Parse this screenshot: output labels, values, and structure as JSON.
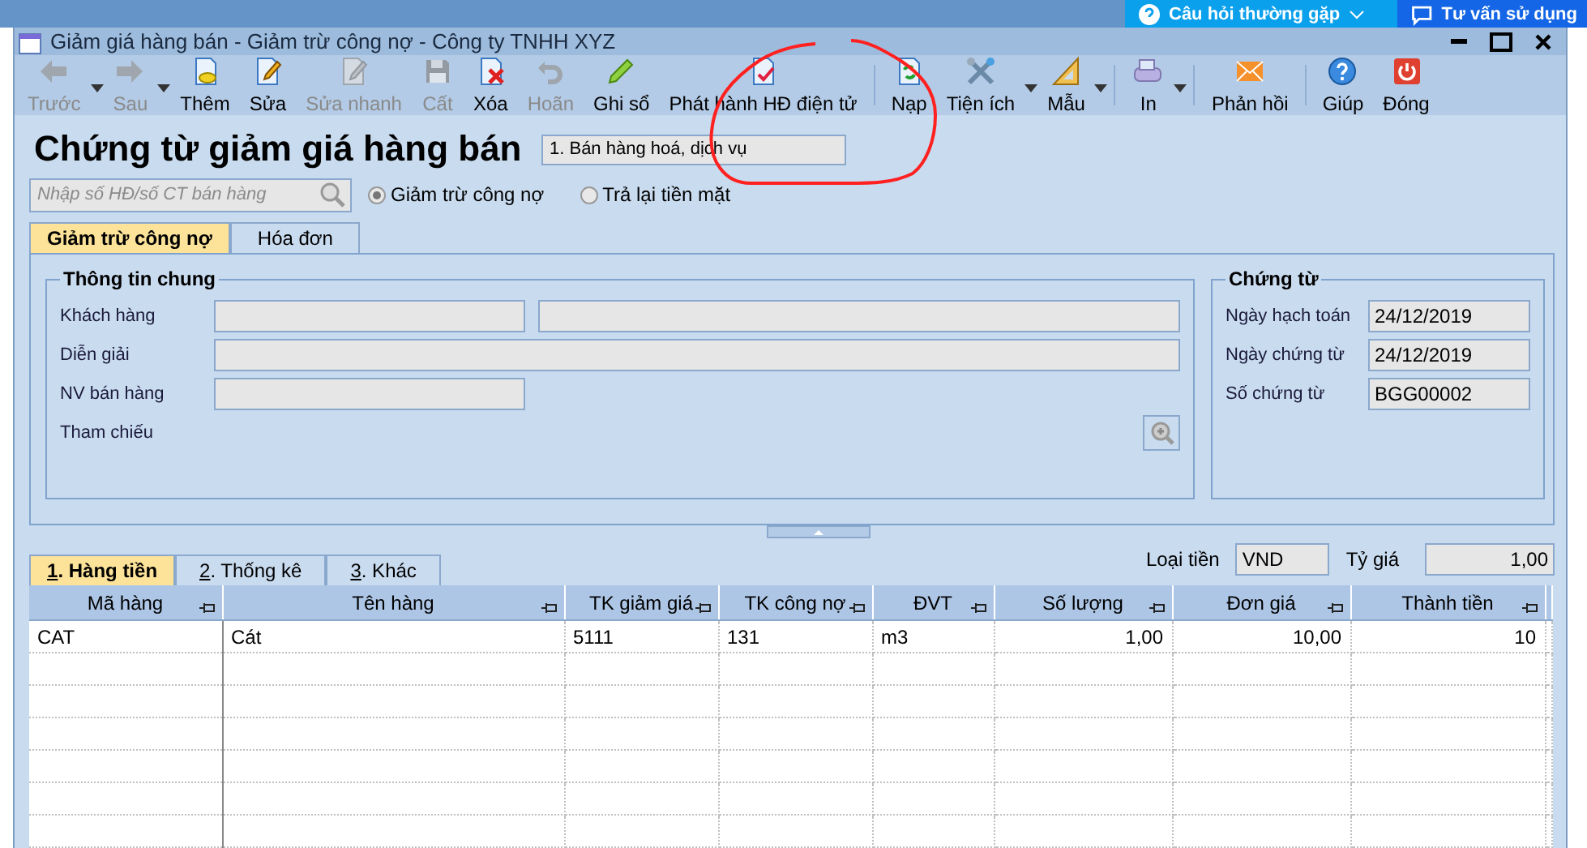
{
  "top_bar": {
    "buttons": [
      {
        "label": "Câu hỏi thường gặp",
        "kind": "faq",
        "dropdown": true
      },
      {
        "label": "Tư vấn sử dụng",
        "kind": "support",
        "dropdown": false
      }
    ]
  },
  "window": {
    "title": "Giảm giá hàng bán - Giảm trừ công nợ - Công ty TNHH XYZ"
  },
  "toolbar": [
    {
      "kind": "prev",
      "label": "Trước",
      "disabled": true,
      "dropdown": true
    },
    {
      "kind": "next",
      "label": "Sau",
      "disabled": true,
      "dropdown": true
    },
    {
      "kind": "add",
      "label": "Thêm",
      "disabled": false,
      "dropdown": false
    },
    {
      "kind": "edit",
      "label": "Sửa",
      "disabled": false,
      "dropdown": false
    },
    {
      "kind": "quick-edit",
      "label": "Sửa nhanh",
      "disabled": true,
      "dropdown": false
    },
    {
      "kind": "save",
      "label": "Cất",
      "disabled": true,
      "dropdown": false
    },
    {
      "kind": "delete",
      "label": "Xóa",
      "disabled": false,
      "dropdown": false
    },
    {
      "kind": "undo",
      "label": "Hoãn",
      "disabled": true,
      "dropdown": false
    },
    {
      "kind": "post",
      "label": "Ghi sổ",
      "disabled": false,
      "dropdown": false
    },
    {
      "kind": "einvoice",
      "label": "Phát hành HĐ điện tử",
      "disabled": false,
      "dropdown": false
    },
    {
      "kind": "separator"
    },
    {
      "kind": "reload",
      "label": "Nạp",
      "disabled": false,
      "dropdown": false
    },
    {
      "kind": "tools",
      "label": "Tiện ích",
      "disabled": false,
      "dropdown": true
    },
    {
      "kind": "template",
      "label": "Mẫu",
      "disabled": false,
      "dropdown": true
    },
    {
      "kind": "separator"
    },
    {
      "kind": "print",
      "label": "In",
      "disabled": false,
      "dropdown": true
    },
    {
      "kind": "separator"
    },
    {
      "kind": "feedback",
      "label": "Phản hồi",
      "disabled": false,
      "dropdown": false
    },
    {
      "kind": "separator"
    },
    {
      "kind": "help",
      "label": "Giúp",
      "disabled": false,
      "dropdown": false
    },
    {
      "kind": "close",
      "label": "Đóng",
      "disabled": false,
      "dropdown": false
    }
  ],
  "form": {
    "title": "Chứng từ giảm giá hàng bán",
    "type_field": {
      "value": "1. Bán hàng hoá, dịch vụ"
    },
    "search": {
      "placeholder": "Nhập số HĐ/số CT bán hàng"
    },
    "options": [
      {
        "label": "Giảm trừ công nợ",
        "selected": true
      },
      {
        "label": "Trả lại tiền mặt",
        "selected": false
      }
    ]
  },
  "tabs": [
    {
      "label": "Giảm trừ công nợ",
      "selected": true
    },
    {
      "label": "Hóa đơn",
      "selected": false
    }
  ],
  "general": {
    "title": "Thông tin chung",
    "rows": [
      {
        "label": "Khách hàng",
        "kind": "double"
      },
      {
        "label": "Diễn giải",
        "kind": "wide"
      },
      {
        "label": "NV bán hàng",
        "kind": "short"
      },
      {
        "label": "Tham chiếu",
        "kind": "lookup"
      }
    ]
  },
  "voucher": {
    "title": "Chứng từ",
    "fields": [
      {
        "label": "Ngày hạch toán",
        "value": "24/12/2019"
      },
      {
        "label": "Ngày chứng từ",
        "value": "24/12/2019"
      },
      {
        "label": "Số chứng từ",
        "value": "BGG00002"
      }
    ]
  },
  "detail_tabs": [
    {
      "label": "1. Hàng tiền",
      "selected": true
    },
    {
      "label": "2. Thống kê",
      "selected": false
    },
    {
      "label": "3. Khác",
      "selected": false
    }
  ],
  "currency": {
    "label": "Loại tiền",
    "value": "VND"
  },
  "rate": {
    "label": "Tỷ giá",
    "value": "1,00"
  },
  "table": {
    "columns": [
      {
        "label": "Mã hàng"
      },
      {
        "label": "Tên hàng"
      },
      {
        "label": "TK giảm giá"
      },
      {
        "label": "TK công nợ"
      },
      {
        "label": "ĐVT"
      },
      {
        "label": "Số lượng"
      },
      {
        "label": "Đơn giá"
      },
      {
        "label": "Thành tiền"
      }
    ],
    "rows": [
      [
        "CAT",
        "Cát",
        "5111",
        "131",
        "m3",
        "1,00",
        "10,00",
        "10"
      ]
    ]
  }
}
